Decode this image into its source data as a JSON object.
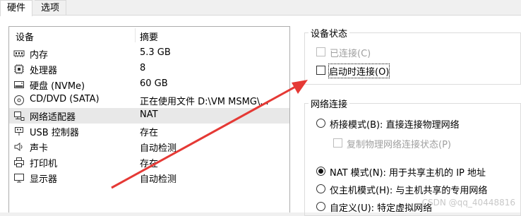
{
  "tabs": [
    {
      "label": "硬件",
      "active": true
    },
    {
      "label": "选项",
      "active": false
    }
  ],
  "hardware_list": {
    "columns": [
      "设备",
      "摘要"
    ],
    "rows": [
      {
        "icon": "memory-icon",
        "name": "内存",
        "summary": "5.3 GB"
      },
      {
        "icon": "processor-icon",
        "name": "处理器",
        "summary": "8"
      },
      {
        "icon": "hard-disk-icon",
        "name": "硬盘 (NVMe)",
        "summary": "60 GB"
      },
      {
        "icon": "cd-dvd-icon",
        "name": "CD/DVD (SATA)",
        "summary": "正在使用文件 D:\\VM MSMG\\..."
      },
      {
        "icon": "network-adapter-icon",
        "name": "网络适配器",
        "summary": "NAT",
        "selected": true
      },
      {
        "icon": "usb-icon",
        "name": "USB 控制器",
        "summary": "存在"
      },
      {
        "icon": "sound-card-icon",
        "name": "声卡",
        "summary": "自动检测"
      },
      {
        "icon": "printer-icon",
        "name": "打印机",
        "summary": "存在"
      },
      {
        "icon": "display-icon",
        "name": "显示器",
        "summary": "自动检测"
      }
    ]
  },
  "device_status": {
    "title": "设备状态",
    "connected": {
      "label": "已连接(C)",
      "checked": false,
      "enabled": false
    },
    "connect_at_power_on": {
      "label": "启动时连接(O)",
      "checked": false,
      "enabled": true
    }
  },
  "network_connection": {
    "title": "网络连接",
    "options": [
      {
        "label": "桥接模式(B): 直接连接物理网络",
        "selected": false
      },
      {
        "label": "NAT 模式(N): 用于共享主机的 IP 地址",
        "selected": true
      },
      {
        "label": "仅主机模式(H): 与主机共享的专用网络",
        "selected": false
      },
      {
        "label": "自定义(U): 特定虚拟网络",
        "selected": false
      }
    ],
    "replicate_state": {
      "label": "复制物理网络连接状态(P)",
      "checked": false,
      "enabled": false
    }
  },
  "watermark": "CSDN @qq_40448816",
  "colors": {
    "annotation_arrow": "#e53935"
  }
}
